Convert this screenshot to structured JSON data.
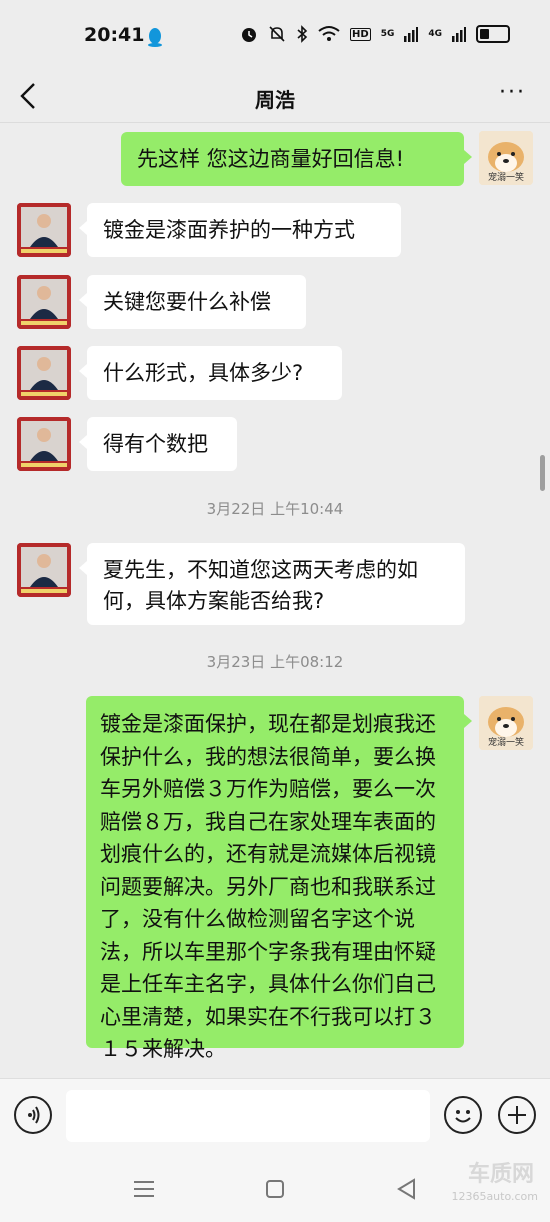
{
  "status": {
    "time": "20:41",
    "signal_labels": [
      "5G",
      "4G"
    ],
    "hd_label": "HD"
  },
  "header": {
    "title": "周浩",
    "more_label": "···"
  },
  "avatars": {
    "right_caption": "宠溺一笑"
  },
  "messages": [
    {
      "side": "right",
      "text": "先这样 您这边商量好回信息!"
    },
    {
      "side": "left",
      "text": "镀金是漆面养护的一种方式"
    },
    {
      "side": "left",
      "text": "关键您要什么补偿"
    },
    {
      "side": "left",
      "text": "什么形式，具体多少?"
    },
    {
      "side": "left",
      "text": "得有个数把"
    },
    {
      "side": "time",
      "text": "3月22日 上午10:44"
    },
    {
      "side": "left",
      "text": "夏先生，不知道您这两天考虑的如何，具体方案能否给我?"
    },
    {
      "side": "time",
      "text": "3月23日 上午08:12"
    },
    {
      "side": "right",
      "text": "镀金是漆面保护，现在都是划痕我还保护什么，我的想法很简单，要么换车另外赔偿３万作为赔偿，要么一次赔偿８万，我自己在家处理车表面的划痕什么的，还有就是流媒体后视镜问题要解决。另外厂商也和我联系过了，没有什么做检测留名字这个说法，所以车里那个字条我有理由怀疑是上任车主名字，具体什么你们自己心里清楚，如果实在不行我可以打３１５来解决。"
    }
  ],
  "watermark": {
    "brand": "车质网",
    "url": "12365auto.com"
  },
  "colors": {
    "background": "#ededed",
    "sent_bubble": "#95ec69",
    "received_bubble": "#ffffff",
    "avatar_left": "#b52a2a"
  }
}
